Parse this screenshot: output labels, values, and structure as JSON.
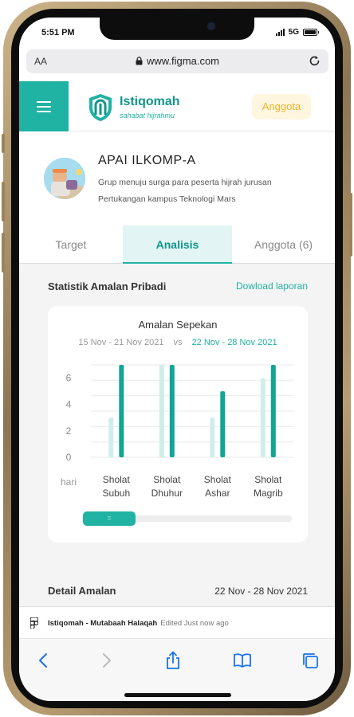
{
  "status_bar": {
    "time": "5:51 PM",
    "network": "5G"
  },
  "browser": {
    "aa_label": "AA",
    "url": "www.figma.com"
  },
  "header": {
    "brand_name": "Istiqomah",
    "tagline": "sahabat hijrahmu",
    "anggota_button": "Anggota"
  },
  "group": {
    "name": "APAI ILKOMP-A",
    "description_line1": "Grup menuju surga para peserta hijrah jurusan",
    "description_line2": "Pertukangan kampus Teknologi Mars"
  },
  "tabs": [
    {
      "label": "Target",
      "active": false
    },
    {
      "label": "Analisis",
      "active": true
    },
    {
      "label": "Anggota (6)",
      "active": false
    }
  ],
  "stats": {
    "title": "Statistik Amalan Pribadi",
    "download_label": "Dowload laporan"
  },
  "chart_data": {
    "type": "bar",
    "title": "Amalan Sepekan",
    "previous_range": "15 Nov - 21 Nov 2021",
    "vs_label": "vs",
    "current_range": "22 Nov - 28 Nov 2021",
    "ylabel": "hari",
    "yticks": [
      0,
      2,
      4,
      6
    ],
    "ylim": [
      0,
      7
    ],
    "categories": [
      [
        "Sholat",
        "Subuh"
      ],
      [
        "Sholat",
        "Dhuhur"
      ],
      [
        "Sholat",
        "Ashar"
      ],
      [
        "Sholat",
        "Magrib"
      ]
    ],
    "series": [
      {
        "values": [
          3,
          7,
          3,
          6
        ],
        "color": "#cfeeea"
      },
      {
        "values": [
          7,
          7,
          5,
          7
        ],
        "color": "#12a593"
      }
    ],
    "scroll_thumb_label": "="
  },
  "detail": {
    "title": "Detail Amalan",
    "range": "22 Nov - 28 Nov 2021"
  },
  "figma_bar": {
    "file_name": "Istiqomah - Mutabaah Halaqah",
    "meta": "Edited Just now ago"
  },
  "colors": {
    "primary": "#20b2a2",
    "primary_dark": "#12968a",
    "accent": "#f0b429"
  }
}
